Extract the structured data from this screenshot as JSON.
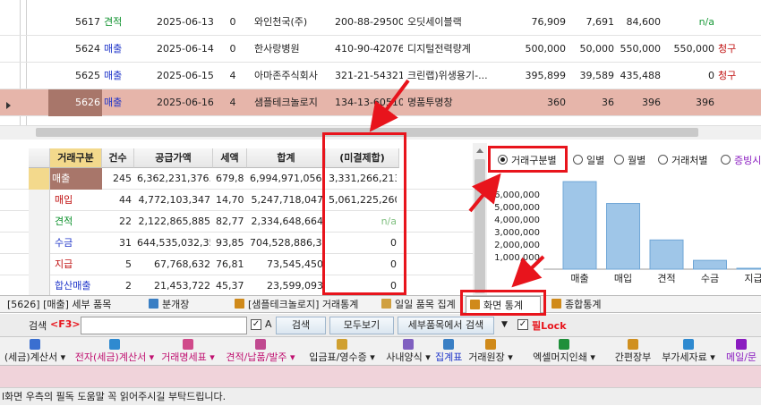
{
  "top_rows": [
    {
      "id": "5617",
      "type": "견적",
      "type_color": "#0a8f2a",
      "date": "2025-06-13",
      "cnt": "0",
      "company": "와인천국(주)",
      "bizno": "200-88-29500",
      "item": "오딧세이블랙",
      "supply": "76,909",
      "tax": "7,691",
      "total": "84,600",
      "extra": "n/a",
      "extra_color": "#1b9a3a",
      "claim": "",
      "selected": false
    },
    {
      "id": "5624",
      "type": "매출",
      "type_color": "#1f35c9",
      "date": "2025-06-14",
      "cnt": "0",
      "company": "한사랑병원",
      "bizno": "410-90-42076",
      "item": "디지털전력량계",
      "supply": "500,000",
      "tax": "50,000",
      "total": "550,000",
      "extra": "550,000",
      "extra_color": "#222",
      "claim": "청구",
      "selected": false
    },
    {
      "id": "5625",
      "type": "매출",
      "type_color": "#1f35c9",
      "date": "2025-06-15",
      "cnt": "4",
      "company": "아마존주식회사",
      "bizno": "321-21-54321",
      "item": "크린랩)위생용기-...",
      "supply": "395,899",
      "tax": "39,589",
      "total": "435,488",
      "extra": "0",
      "extra_color": "#222",
      "claim": "청구",
      "selected": false
    },
    {
      "id": "5626",
      "type": "매출",
      "type_color": "#1f35c9",
      "date": "2025-06-16",
      "cnt": "4",
      "company": "샘플테크놀로지",
      "bizno": "134-13-60510",
      "item": "명품투명창",
      "supply": "360",
      "tax": "36",
      "total": "396",
      "extra": "396",
      "extra_color": "#222",
      "claim": "",
      "selected": true
    }
  ],
  "summary_headers": [
    "거래구분",
    "건수",
    "공급가액",
    "세액",
    "합계",
    "(미결제합)"
  ],
  "summary_rows": [
    {
      "label": "매출",
      "label_color": "#222",
      "count": "245",
      "supply": "6,362,231,376.5",
      "tax": "679,85",
      "total": "6,994,971,056,35",
      "unpaid": "3,331,266,213",
      "unpaid_color": "#222",
      "highlight": true
    },
    {
      "label": "매입",
      "label_color": "#c01010",
      "count": "44",
      "supply": "4,772,103,347",
      "tax": "14,700",
      "total": "5,247,718,047",
      "unpaid": "5,061,225,260",
      "unpaid_color": "#222",
      "highlight": false
    },
    {
      "label": "견적",
      "label_color": "#0a8f2a",
      "count": "22",
      "supply": "2,122,865,885",
      "tax": "82,779",
      "total": "2,334,648,664",
      "unpaid": "n/a",
      "unpaid_color": "#7fbf7f",
      "highlight": false
    },
    {
      "label": "수금",
      "label_color": "#1f35c9",
      "count": "31",
      "supply": "644,535,032,35",
      "tax": "93,854",
      "total": "704,528,886,35",
      "unpaid": "0",
      "unpaid_color": "#222",
      "highlight": false
    },
    {
      "label": "지급",
      "label_color": "#c01010",
      "count": "5",
      "supply": "67,768,632",
      "tax": "76,818",
      "total": "73,545,450",
      "unpaid": "0",
      "unpaid_color": "#222",
      "highlight": false
    },
    {
      "label": "합산매출",
      "label_color": "#1f35c9",
      "count": "2",
      "supply": "21,453,722",
      "tax": "45,371",
      "total": "23,599,093",
      "unpaid": "0",
      "unpaid_color": "#222",
      "highlight": false
    }
  ],
  "chart_options": {
    "items": [
      "거래구분별",
      "일별",
      "월별",
      "거래처별",
      "증빙시"
    ],
    "selected": 0
  },
  "chart_data": {
    "type": "bar",
    "categories": [
      "매출",
      "매입",
      "견적",
      "수금",
      "지급"
    ],
    "values": [
      6994971056,
      5247718047,
      2334648664,
      704528886,
      73545450
    ],
    "ylim": [
      0,
      7000000000
    ],
    "yticks": [
      "1,000,000",
      "2,000,000",
      "3,000,000",
      "4,000,000",
      "5,000,000",
      "6,000,000"
    ],
    "bar_color": "#9fc6e8",
    "bar_edge": "#6fa6d6"
  },
  "tabs": [
    {
      "label": "[5626] [매출] 세부 품목",
      "icon": ""
    },
    {
      "label": "분개장",
      "icon": "book"
    },
    {
      "label": "[샘플테크놀로지] 거래통계",
      "icon": "chart"
    },
    {
      "label": "일일 품목 집계",
      "icon": "box"
    },
    {
      "label": "화면 통계",
      "icon": "chart",
      "active": true
    },
    {
      "label": "종합통계",
      "icon": "chart"
    }
  ],
  "search": {
    "label": "검색",
    "key": "<F3>",
    "value": "",
    "checkbox_label": "A",
    "search_btn": "검색",
    "showall_btn": "모두보기",
    "detail_btn": "세부품목에서 검색",
    "lock_label": "필Lock"
  },
  "toolbar": [
    {
      "label": "(세금)계산서",
      "color": "#222",
      "caret": true
    },
    {
      "label": "전자(세금)계산서",
      "color": "#c01070",
      "caret": true
    },
    {
      "label": "거래명세표",
      "color": "#c01070",
      "caret": true
    },
    {
      "label": "견적/납품/발주",
      "color": "#c01070",
      "caret": true
    },
    {
      "label": "입금표/영수증",
      "color": "#222",
      "caret": true
    },
    {
      "label": "사내양식",
      "color": "#222",
      "caret": true
    },
    {
      "label": "집계표",
      "color": "#1f35c9",
      "caret": false
    },
    {
      "label": "거래원장",
      "color": "#222",
      "caret": true
    },
    {
      "label": "엑셀머지인쇄",
      "color": "#222",
      "caret": true
    },
    {
      "label": "간편장부",
      "color": "#222",
      "caret": false
    },
    {
      "label": "부가세자료",
      "color": "#222",
      "caret": true
    },
    {
      "label": "메일/문",
      "color": "#8a1cc0",
      "caret": false
    }
  ],
  "status_text": "l화면 우측의 필독 도움말 꼭 읽어주시길 부탁드립니다."
}
